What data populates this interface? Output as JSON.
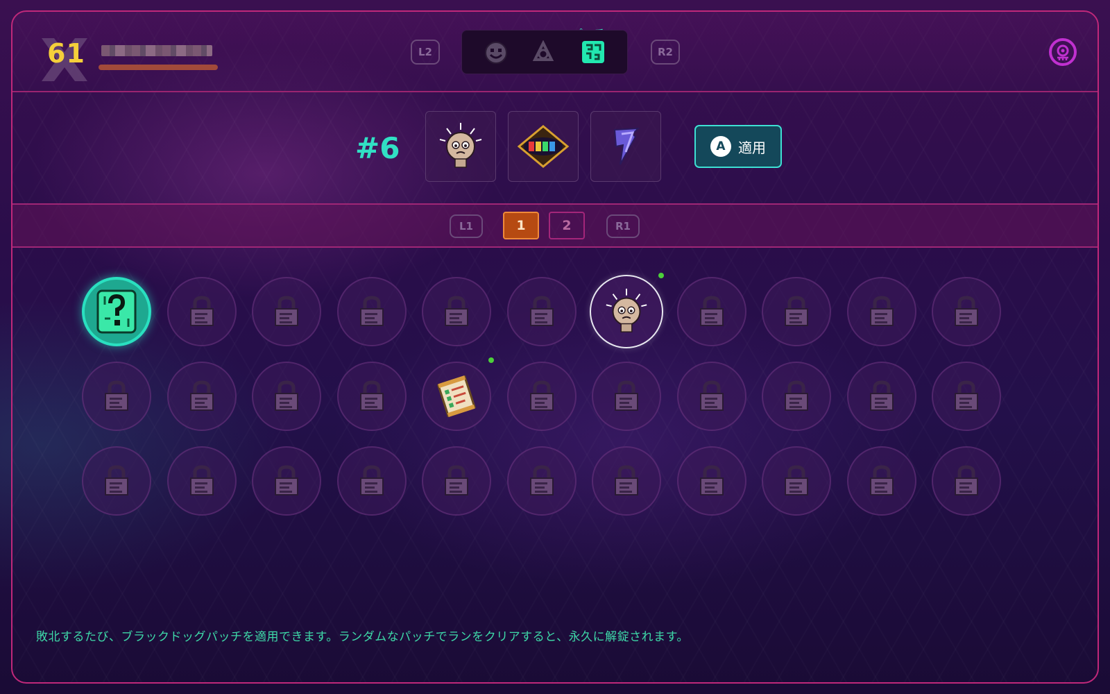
{
  "header": {
    "level": "61",
    "left_trigger": "L2",
    "right_trigger": "R2",
    "active_tab_label": "パッチ",
    "tabs": [
      {
        "icon": "smiley-face-icon"
      },
      {
        "icon": "triquetra-icon"
      },
      {
        "icon": "patch-icon",
        "active": true
      }
    ],
    "settings_icon": "skull-eye-icon"
  },
  "loadout": {
    "slot_number": "#6",
    "slots": [
      {
        "icon": "crying-head-icon"
      },
      {
        "icon": "gods-emblem-icon"
      },
      {
        "icon": "lightning-blade-icon"
      }
    ],
    "apply_key": "A",
    "apply_label": "適用"
  },
  "pagination": {
    "left_bumper": "L1",
    "right_bumper": "R1",
    "pages": [
      "1",
      "2"
    ],
    "current_page": "1"
  },
  "grid": {
    "rows": 3,
    "columns": 11,
    "cells": [
      [
        "mystery",
        "locked",
        "locked",
        "locked",
        "locked",
        "locked",
        "crying-head",
        "locked",
        "locked",
        "locked",
        "locked"
      ],
      [
        "locked",
        "locked",
        "locked",
        "locked",
        "scroll",
        "locked",
        "locked",
        "locked",
        "locked",
        "locked",
        "locked"
      ],
      [
        "locked",
        "locked",
        "locked",
        "locked",
        "locked",
        "locked",
        "locked",
        "locked",
        "locked",
        "locked",
        "locked"
      ]
    ],
    "selected": {
      "row": 0,
      "col": 6
    },
    "new_indicators": [
      {
        "row": 0,
        "col": 6
      },
      {
        "row": 1,
        "col": 4
      }
    ]
  },
  "footer": {
    "hint": "敗北するたび、ブラックドッグパッチを適用できます。ランダムなパッチでランをクリアすると、永久に解錠されます。"
  },
  "colors": {
    "accent_teal": "#31e0c4",
    "border_magenta": "#c0287a",
    "active_page": "#b64a12",
    "level_gold": "#f5cf3a"
  }
}
